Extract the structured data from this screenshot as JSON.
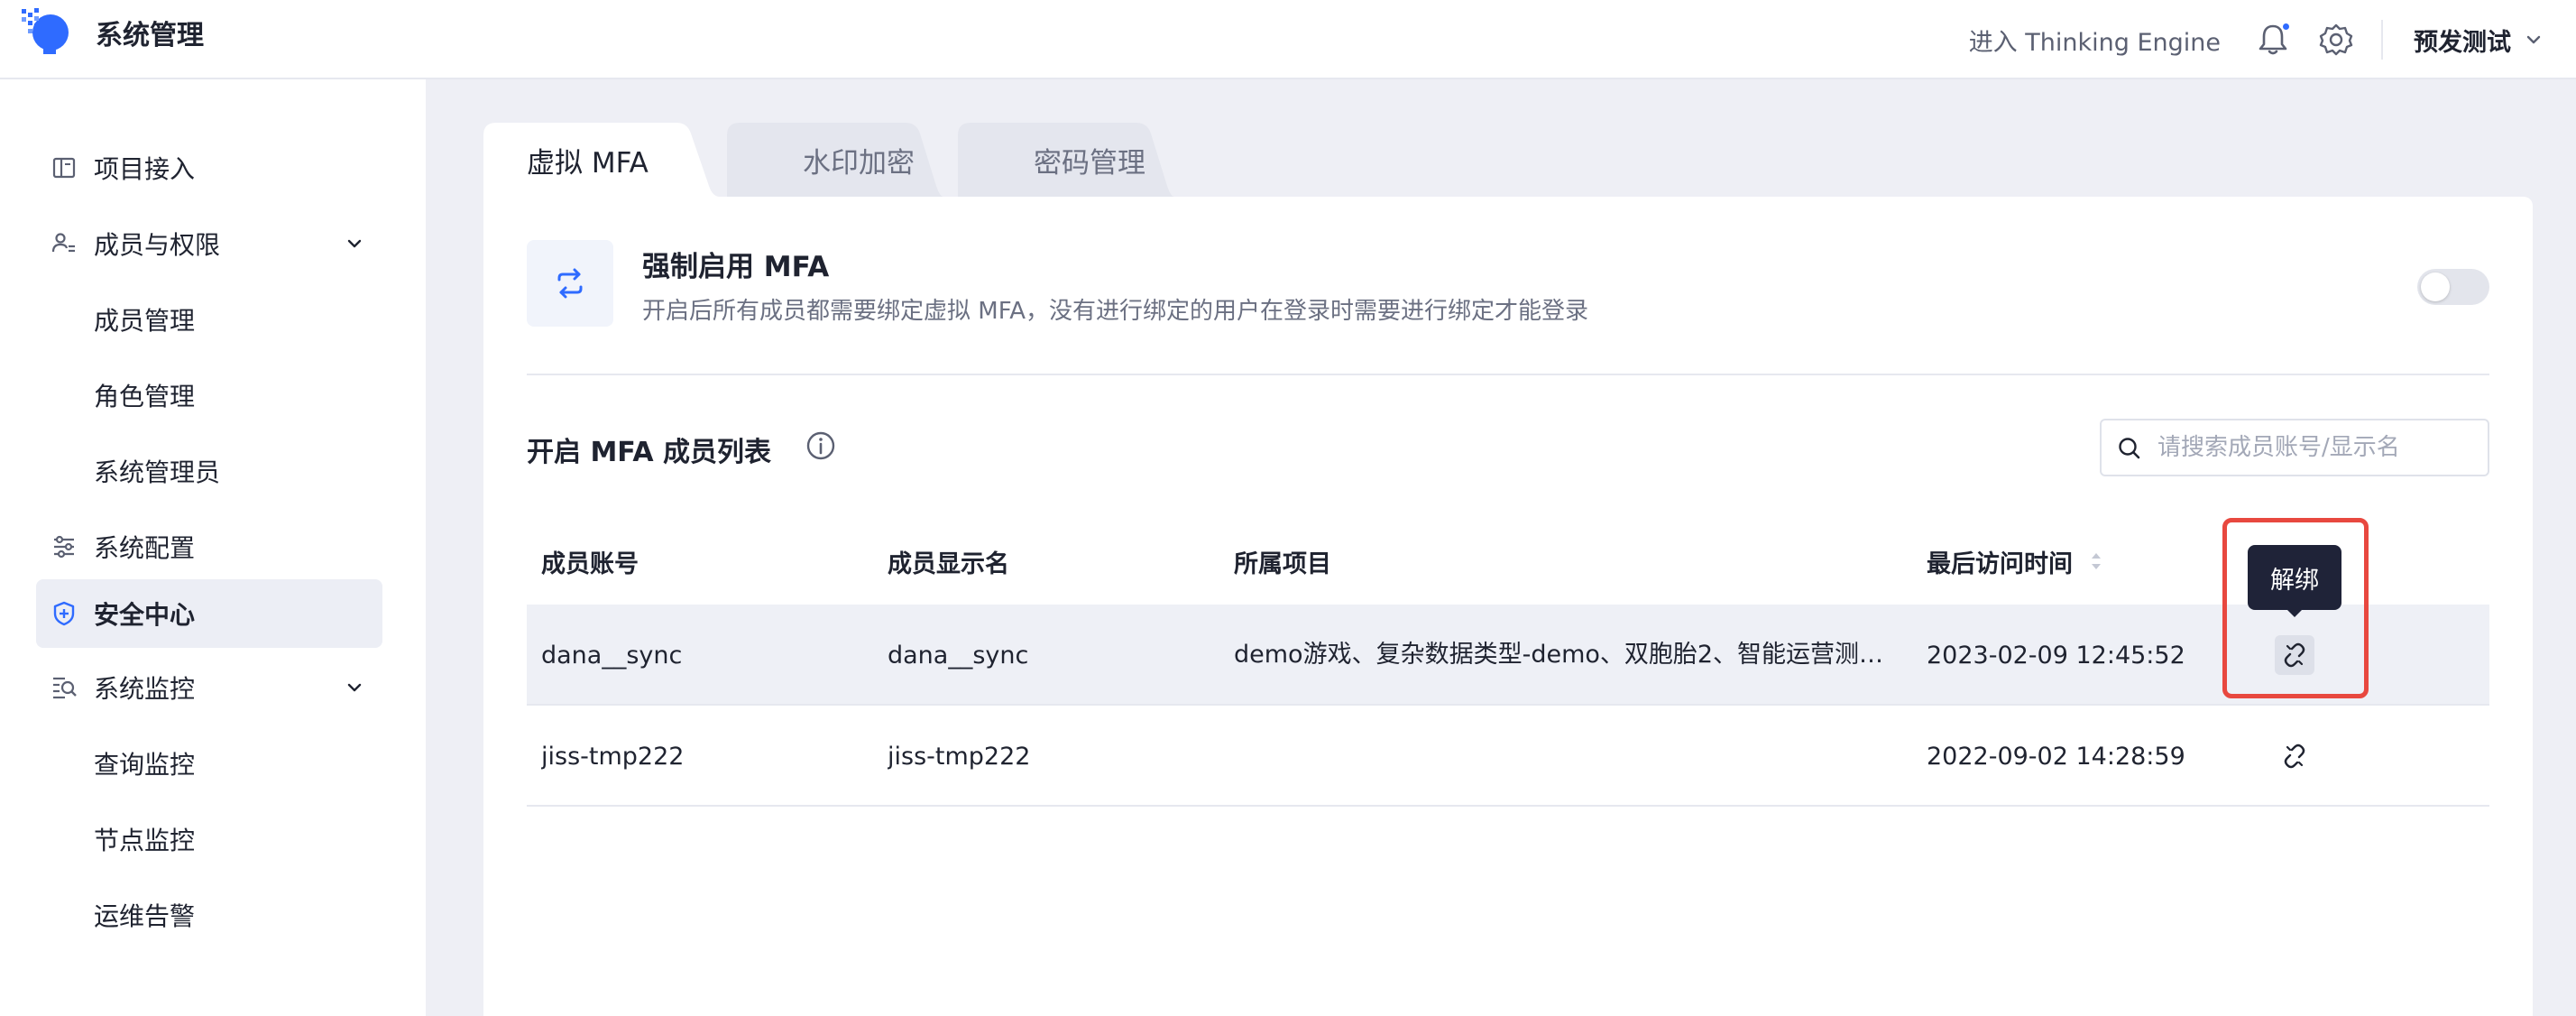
{
  "app": {
    "title": "系统管理"
  },
  "header": {
    "enter_link": "进入 Thinking Engine",
    "environment": "预发测试",
    "notification_dot_color": "#2f6bff"
  },
  "sidebar": {
    "items": [
      {
        "label": "项目接入",
        "icon": "book-icon"
      },
      {
        "label": "成员与权限",
        "icon": "members-icon",
        "expandable": true
      },
      {
        "label": "成员管理"
      },
      {
        "label": "角色管理"
      },
      {
        "label": "系统管理员"
      },
      {
        "label": "系统配置",
        "icon": "sliders-icon"
      },
      {
        "label": "安全中心",
        "icon": "shield-icon",
        "active": true
      },
      {
        "label": "系统监控",
        "icon": "monitor-search-icon",
        "expandable": true
      },
      {
        "label": "查询监控"
      },
      {
        "label": "节点监控"
      },
      {
        "label": "运维告警"
      }
    ]
  },
  "tabs": [
    {
      "label": "虚拟 MFA",
      "active": true
    },
    {
      "label": "水印加密"
    },
    {
      "label": "密码管理"
    }
  ],
  "mfa": {
    "title": "强制启用 MFA",
    "description": "开启后所有成员都需要绑定虚拟 MFA，没有进行绑定的用户在登录时需要进行绑定才能登录",
    "enforced": false
  },
  "member_list": {
    "title": "开启 MFA 成员列表",
    "search_placeholder": "请搜索成员账号/显示名",
    "columns": [
      "成员账号",
      "成员显示名",
      "所属项目",
      "最后访问时间"
    ],
    "rows": [
      {
        "account": "dana__sync",
        "display_name": "dana__sync",
        "projects": "demo游戏、复杂数据类型-demo、双胞胎2、智能运营测…",
        "last_access": "2023-02-09 12:45:52"
      },
      {
        "account": "jiss-tmp222",
        "display_name": "jiss-tmp222",
        "projects": "",
        "last_access": "2022-09-02 14:28:59"
      }
    ],
    "action_tooltip": "解绑"
  },
  "colors": {
    "accent": "#2f6bff",
    "highlight": "#e8483f",
    "tooltip_bg": "#1f2338"
  }
}
